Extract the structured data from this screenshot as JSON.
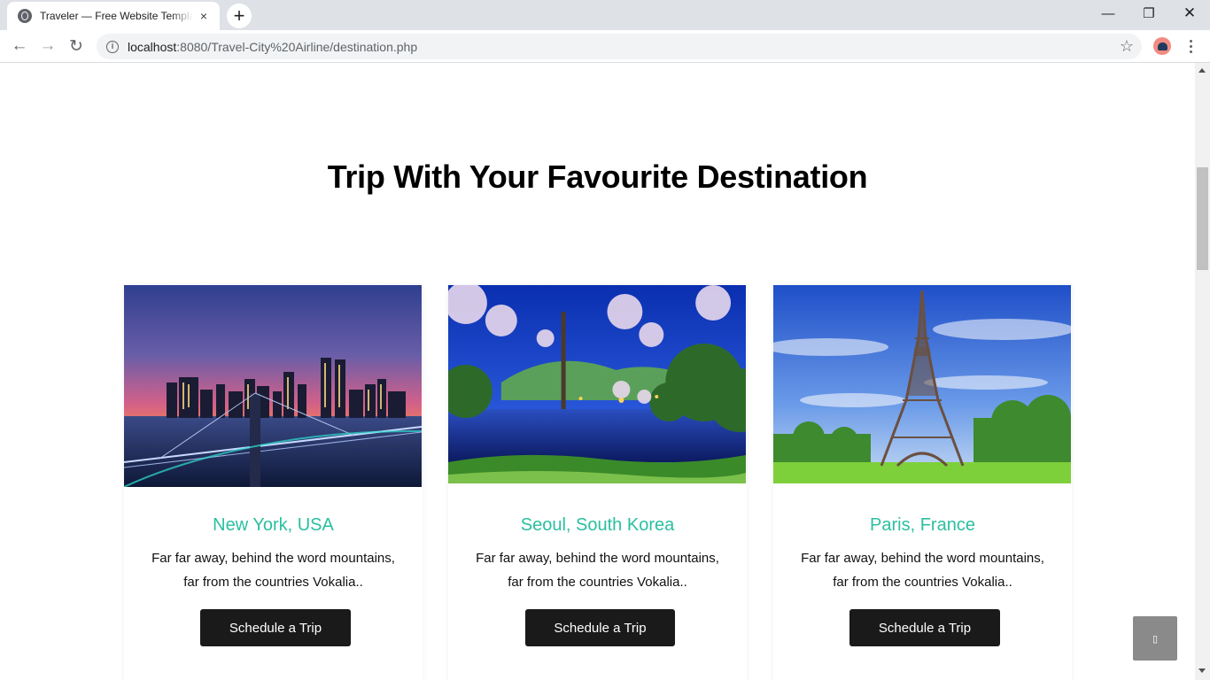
{
  "browser": {
    "tab_title": "Traveler — Free Website Template",
    "tab_close": "×",
    "new_tab": "+",
    "url_host": "localhost",
    "url_rest": ":8080/Travel-City%20Airline/destination.php",
    "window": {
      "minimize": "—",
      "restore": "❐",
      "close": "✕"
    }
  },
  "page": {
    "title": "Trip With Your Favourite Destination",
    "back_to_top": "▯"
  },
  "destinations": [
    {
      "city": "New York, USA",
      "line1": "Far far away, behind the word mountains,",
      "line2": "far from the countries Vokalia..",
      "button": "Schedule a Trip"
    },
    {
      "city": "Seoul, South Korea",
      "line1": "Far far away, behind the word mountains,",
      "line2": "far from the countries Vokalia..",
      "button": "Schedule a Trip"
    },
    {
      "city": "Paris, France",
      "line1": "Far far away, behind the word mountains,",
      "line2": "far from the countries Vokalia..",
      "button": "Schedule a Trip"
    }
  ],
  "colors": {
    "accent": "#2bbfa0",
    "button": "#1a1a1a"
  }
}
